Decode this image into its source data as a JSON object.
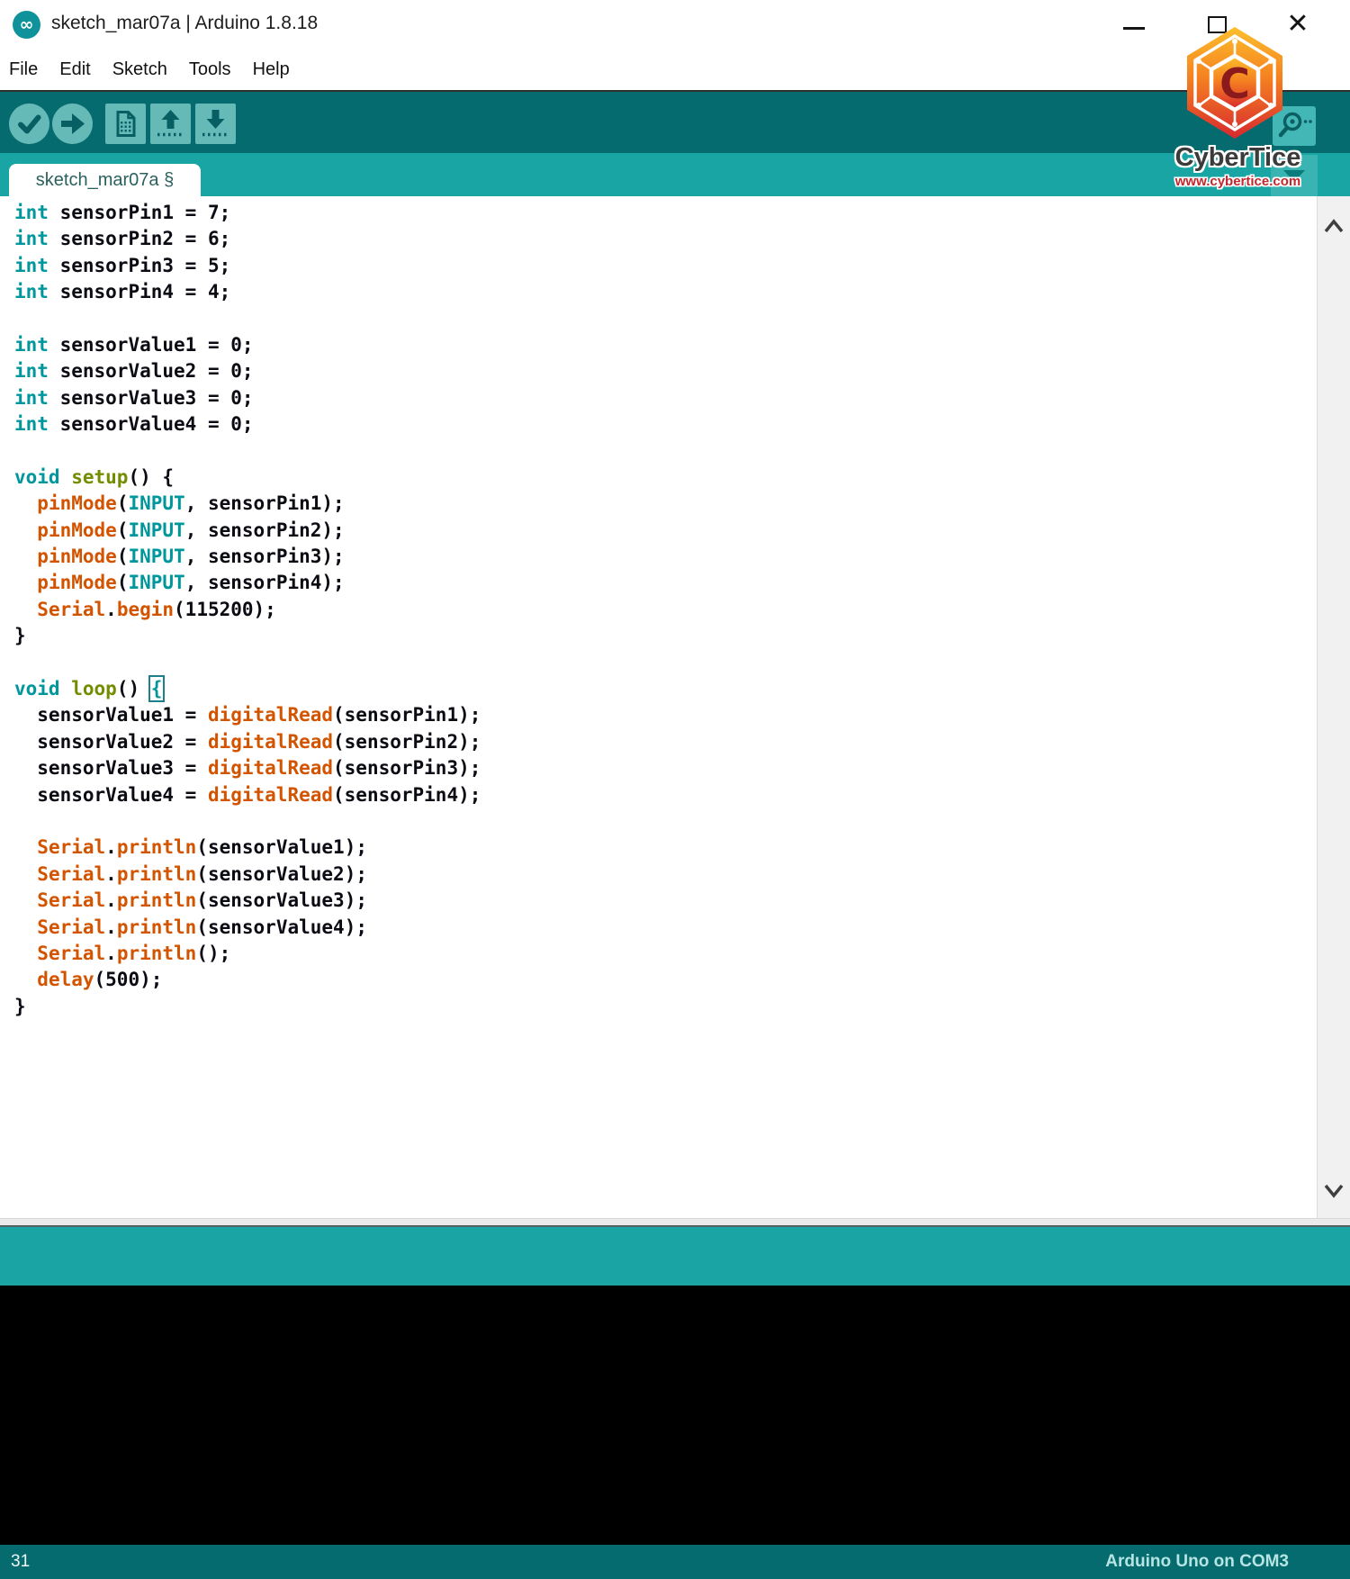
{
  "window": {
    "title": "sketch_mar07a | Arduino 1.8.18",
    "controls": {
      "close_glyph": "✕"
    }
  },
  "menu": {
    "items": [
      "File",
      "Edit",
      "Sketch",
      "Tools",
      "Help"
    ]
  },
  "toolbar": {
    "buttons": [
      "verify",
      "upload",
      "new",
      "open",
      "save",
      "serial-monitor"
    ]
  },
  "icons": {
    "app": "arduino-infinity-icon",
    "toolbar": [
      "verify-check-icon",
      "upload-arrow-icon",
      "new-sketch-icon",
      "open-sketch-icon",
      "save-sketch-icon",
      "serial-monitor-icon"
    ],
    "window": [
      "minimize-icon",
      "maximize-icon",
      "close-icon"
    ],
    "tab_strip": "tab-list-dropdown-icon",
    "scrollbar": [
      "scroll-up-icon",
      "scroll-down-icon"
    ]
  },
  "tabs": {
    "active_label": "sketch_mar07a §"
  },
  "editor": {
    "lines": [
      [
        [
          "k",
          "int"
        ],
        [
          "p",
          " sensorPin1 = 7;"
        ]
      ],
      [
        [
          "k",
          "int"
        ],
        [
          "p",
          " sensorPin2 = 6;"
        ]
      ],
      [
        [
          "k",
          "int"
        ],
        [
          "p",
          " sensorPin3 = 5;"
        ]
      ],
      [
        [
          "k",
          "int"
        ],
        [
          "p",
          " sensorPin4 = 4;"
        ]
      ],
      [],
      [
        [
          "k",
          "int"
        ],
        [
          "p",
          " sensorValue1 = 0;"
        ]
      ],
      [
        [
          "k",
          "int"
        ],
        [
          "p",
          " sensorValue2 = 0;"
        ]
      ],
      [
        [
          "k",
          "int"
        ],
        [
          "p",
          " sensorValue3 = 0;"
        ]
      ],
      [
        [
          "k",
          "int"
        ],
        [
          "p",
          " sensorValue4 = 0;"
        ]
      ],
      [],
      [
        [
          "k",
          "void"
        ],
        [
          "p",
          " "
        ],
        [
          "o",
          "setup"
        ],
        [
          "p",
          "() {"
        ]
      ],
      [
        [
          "p",
          "  "
        ],
        [
          "f",
          "pinMode"
        ],
        [
          "p",
          "("
        ],
        [
          "k",
          "INPUT"
        ],
        [
          "p",
          ", sensorPin1);"
        ]
      ],
      [
        [
          "p",
          "  "
        ],
        [
          "f",
          "pinMode"
        ],
        [
          "p",
          "("
        ],
        [
          "k",
          "INPUT"
        ],
        [
          "p",
          ", sensorPin2);"
        ]
      ],
      [
        [
          "p",
          "  "
        ],
        [
          "f",
          "pinMode"
        ],
        [
          "p",
          "("
        ],
        [
          "k",
          "INPUT"
        ],
        [
          "p",
          ", sensorPin3);"
        ]
      ],
      [
        [
          "p",
          "  "
        ],
        [
          "f",
          "pinMode"
        ],
        [
          "p",
          "("
        ],
        [
          "k",
          "INPUT"
        ],
        [
          "p",
          ", sensorPin4);"
        ]
      ],
      [
        [
          "p",
          "  "
        ],
        [
          "f",
          "Serial"
        ],
        [
          "p",
          "."
        ],
        [
          "f",
          "begin"
        ],
        [
          "p",
          "(115200);"
        ]
      ],
      [
        [
          "p",
          "}"
        ]
      ],
      [],
      [
        [
          "k",
          "void"
        ],
        [
          "p",
          " "
        ],
        [
          "o",
          "loop"
        ],
        [
          "p",
          "() "
        ],
        [
          "m",
          "{"
        ]
      ],
      [
        [
          "p",
          "  sensorValue1 = "
        ],
        [
          "f",
          "digitalRead"
        ],
        [
          "p",
          "(sensorPin1);"
        ]
      ],
      [
        [
          "p",
          "  sensorValue2 = "
        ],
        [
          "f",
          "digitalRead"
        ],
        [
          "p",
          "(sensorPin2);"
        ]
      ],
      [
        [
          "p",
          "  sensorValue3 = "
        ],
        [
          "f",
          "digitalRead"
        ],
        [
          "p",
          "(sensorPin3);"
        ]
      ],
      [
        [
          "p",
          "  sensorValue4 = "
        ],
        [
          "f",
          "digitalRead"
        ],
        [
          "p",
          "(sensorPin4);"
        ]
      ],
      [],
      [
        [
          "p",
          "  "
        ],
        [
          "f",
          "Serial"
        ],
        [
          "p",
          "."
        ],
        [
          "f",
          "println"
        ],
        [
          "p",
          "(sensorValue1);"
        ]
      ],
      [
        [
          "p",
          "  "
        ],
        [
          "f",
          "Serial"
        ],
        [
          "p",
          "."
        ],
        [
          "f",
          "println"
        ],
        [
          "p",
          "(sensorValue2);"
        ]
      ],
      [
        [
          "p",
          "  "
        ],
        [
          "f",
          "Serial"
        ],
        [
          "p",
          "."
        ],
        [
          "f",
          "println"
        ],
        [
          "p",
          "(sensorValue3);"
        ]
      ],
      [
        [
          "p",
          "  "
        ],
        [
          "f",
          "Serial"
        ],
        [
          "p",
          "."
        ],
        [
          "f",
          "println"
        ],
        [
          "p",
          "(sensorValue4);"
        ]
      ],
      [
        [
          "p",
          "  "
        ],
        [
          "f",
          "Serial"
        ],
        [
          "p",
          "."
        ],
        [
          "f",
          "println"
        ],
        [
          "p",
          "();"
        ]
      ],
      [
        [
          "p",
          "  "
        ],
        [
          "f",
          "delay"
        ],
        [
          "p",
          "(500);"
        ]
      ],
      [
        [
          "p",
          "}"
        ]
      ]
    ]
  },
  "status": {
    "line_number": "31",
    "board": "Arduino Uno on COM3"
  },
  "watermark": {
    "brand": "CyberTice",
    "url": "www.cybertice.com",
    "letter": "C"
  },
  "colors": {
    "keyword_teal": "#00979C",
    "function_orange": "#D35400",
    "keyword_olive": "#728E00",
    "toolbar_teal": "#056b6e",
    "strip_teal": "#1aa5a5",
    "logo_orange": "#F58220",
    "logo_red": "#D7282F"
  }
}
